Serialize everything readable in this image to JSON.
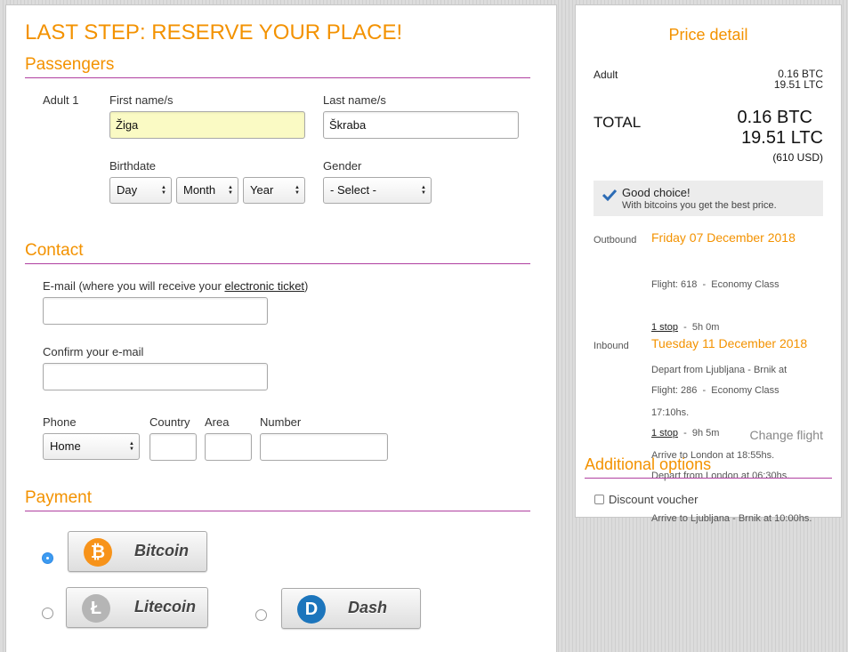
{
  "page_title": "LAST STEP: RESERVE YOUR PLACE!",
  "passengers": {
    "heading": "Passengers",
    "passenger_label": "Adult 1",
    "first_name_label": "First name/s",
    "first_name_value": "Žiga",
    "last_name_label": "Last name/s",
    "last_name_value": "Škraba",
    "birthdate_label": "Birthdate",
    "day": "Day",
    "month": "Month",
    "year": "Year",
    "gender_label": "Gender",
    "gender": "- Select -"
  },
  "contact": {
    "heading": "Contact",
    "email_label_pre": "E-mail (where you will receive your ",
    "email_label_link": "electronic ticket",
    "email_label_post": ")",
    "confirm_label": "Confirm your e-mail",
    "phone_label": "Phone",
    "phone_type": "Home",
    "country_label": "Country",
    "area_label": "Area",
    "number_label": "Number"
  },
  "payment": {
    "heading": "Payment",
    "options": [
      {
        "name": "Bitcoin",
        "symbol": "₿",
        "color": "#f7931a",
        "selected": true
      },
      {
        "name": "Litecoin",
        "symbol": "Ł",
        "color": "#b5b5b5",
        "selected": false
      },
      {
        "name": "Dash",
        "symbol": "D",
        "color": "#1c75bc",
        "selected": false
      }
    ]
  },
  "price": {
    "heading": "Price detail",
    "adult_label": "Adult",
    "adult_btc": "0.16 BTC",
    "adult_ltc": "19.51 LTC",
    "total_label": "TOTAL",
    "total_btc": "0.16",
    "total_btc_unit": "BTC",
    "total_ltc": "19.51",
    "total_ltc_unit": "LTC",
    "total_usd": "(610 USD)",
    "good_choice_title": "Good choice!",
    "good_choice_text": "With bitcoins you get the best price."
  },
  "outbound": {
    "label": "Outbound",
    "date": "Friday 07 December 2018",
    "flight": "Flight: 618  -  Economy Class",
    "stops": "1 stop",
    "duration": "  -  5h 0m",
    "depart": "Depart from Ljubljana - Brnik at",
    "depart_time": "17:10hs.",
    "arrive": "Arrive to London at 18:55hs."
  },
  "inbound": {
    "label": "Inbound",
    "date": "Tuesday 11 December 2018",
    "flight": "Flight: 286  -  Economy Class",
    "stops": "1 stop",
    "duration": "  -  9h 5m",
    "depart": "Depart from London at 06:30hs.",
    "arrive": "Arrive to Ljubljana - Brnik at 10:00hs."
  },
  "change_flight": "Change flight",
  "additional": {
    "heading": "Additional options",
    "discount_label": "Discount voucher"
  },
  "colors": {
    "accent": "#f39200",
    "rule": "#b03fa0",
    "radio_selected": "#3d9bf0"
  }
}
